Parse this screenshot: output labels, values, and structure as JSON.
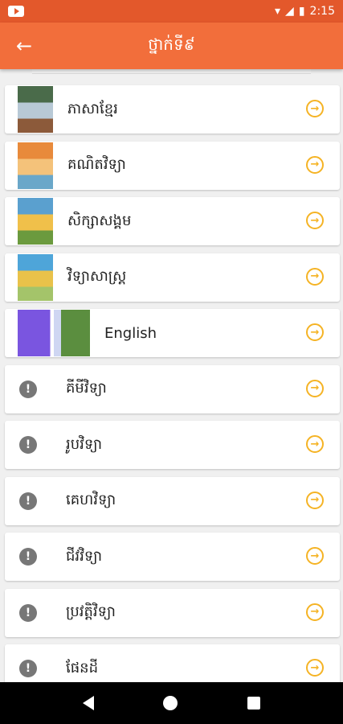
{
  "status_bar": {
    "time": "2:15"
  },
  "app_bar": {
    "title": "ថ្នាក់ទី៩"
  },
  "subjects": [
    {
      "label": "ភាសាខ្មែរ",
      "kind": "book",
      "cover": [
        "#4a6b4a",
        "#b8c9d6",
        "#8c5a3a"
      ]
    },
    {
      "label": "គណិតវិទ្យា",
      "kind": "book",
      "cover": [
        "#e88a3b",
        "#f4c27a",
        "#6aa7c9"
      ]
    },
    {
      "label": "សិក្សាសង្គម",
      "kind": "book",
      "cover": [
        "#5aa0cf",
        "#f0c04a",
        "#6b9a3e"
      ]
    },
    {
      "label": "វិទ្យាសាស្ត្រ",
      "kind": "book",
      "cover": [
        "#4ea5d9",
        "#e9c24a",
        "#a4c46a"
      ]
    },
    {
      "label": "English",
      "kind": "wide",
      "cover": [
        "#7a55e0",
        "#cfd6f2",
        "#5b8e3f"
      ]
    },
    {
      "label": "គីមីវិទ្យា",
      "kind": "alert"
    },
    {
      "label": "រូបវិទ្យា",
      "kind": "alert"
    },
    {
      "label": "គេហវិទ្យា",
      "kind": "alert"
    },
    {
      "label": "ជីវវិទ្យា",
      "kind": "alert"
    },
    {
      "label": "ប្រវត្តិវិទ្យា",
      "kind": "alert"
    },
    {
      "label": "ផែនដី",
      "kind": "alert"
    }
  ],
  "icons": {
    "back": "arrow-left-icon",
    "go": "arrow-circle-right-icon",
    "unavailable": "exclamation-circle-icon"
  },
  "colors": {
    "status_bar": "#e3582b",
    "app_bar": "#f26e3b",
    "accent_arrow": "#f5b324"
  }
}
